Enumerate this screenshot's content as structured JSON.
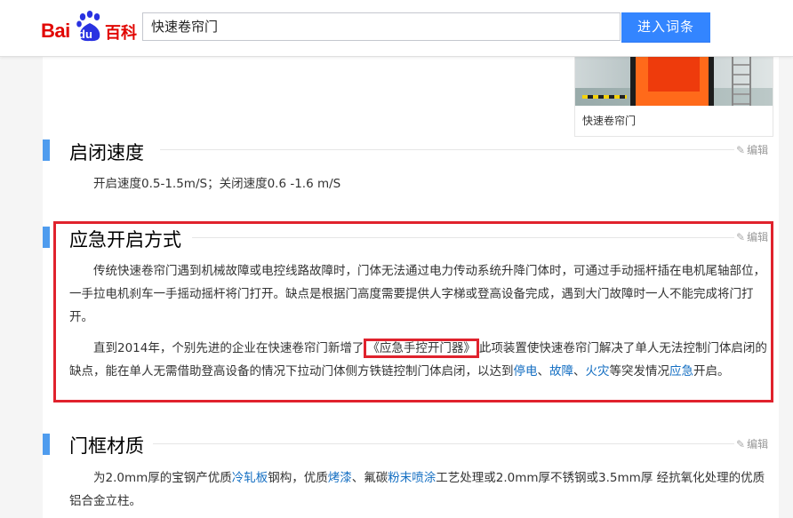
{
  "header": {
    "logo_bai": "Bai",
    "logo_du": "du",
    "logo_baike": "百科",
    "search_value": "快速卷帘门",
    "search_button": "进入词条"
  },
  "image_card": {
    "caption": "快速卷帘门"
  },
  "edit_label": "编辑",
  "sections": [
    {
      "title": "启闭速度",
      "paragraphs": [
        "开启速度0.5-1.5m/S；关闭速度0.6 -1.6 m/S"
      ]
    },
    {
      "title": "应急开启方式",
      "p1": "传统快速卷帘门遇到机械故障或电控线路故障时，门体无法通过电力传动系统升降门体时，可通过手动摇杆插在电机尾轴部位，一手拉电机刹车一手摇动摇杆将门打开。缺点是根据门高度需要提供人字梯或登高设备完成，遇到大门故障时一人不能完成将门打开。",
      "p2_a": "直到2014年，个别先进的企业在快速卷帘门新增了",
      "p2_box": "《应急手控开门器》",
      "p2_b": "此项装置使快速卷帘门解决了单人无法控制门体启闭的缺点，能在单人无需借助登高设备的情况下拉动门体侧方铁链控制门体启闭，以达到",
      "link_1": "停电",
      "sep_1": "、",
      "link_2": "故障",
      "sep_2": "、",
      "link_3": "火灾",
      "p2_c": "等突发情况",
      "link_4": "应急",
      "p2_d": "开启。"
    },
    {
      "title": "门框材质",
      "p_a": "为2.0mm厚的宝钢产优质",
      "link_1": "冷轧板",
      "p_b": "钢构，优质",
      "link_2": "烤漆",
      "p_c": "、氟碳",
      "link_3": "粉末喷涂",
      "p_d": "工艺处理或2.0mm厚不锈钢或3.5mm厚 经抗氧化处理的优质铝合金立柱。"
    }
  ],
  "colors": {
    "accent_blue": "#3385ff",
    "section_bar": "#4f9cee",
    "highlight_red": "#e0222d",
    "link": "#136ec2",
    "logo_red": "#e10602"
  }
}
